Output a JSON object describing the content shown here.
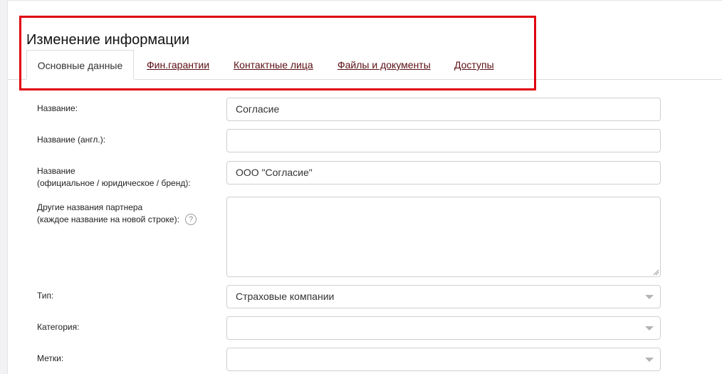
{
  "page": {
    "title": "Изменение информации"
  },
  "tabs": [
    {
      "label": "Основные данные",
      "active": true
    },
    {
      "label": "Фин.гарантии",
      "active": false
    },
    {
      "label": "Контактные лица",
      "active": false
    },
    {
      "label": "Файлы и документы",
      "active": false
    },
    {
      "label": "Доступы",
      "active": false
    }
  ],
  "form": {
    "name": {
      "label": "Название:",
      "value": "Согласие"
    },
    "name_en": {
      "label": "Название (англ.):",
      "value": ""
    },
    "official_name": {
      "label_line1": "Название",
      "label_line2": "(официальное / юридическое / бренд):",
      "value": "ООО \"Согласие\""
    },
    "other_names": {
      "label_line1": "Другие названия партнера",
      "label_line2": "(каждое название на новой строке):",
      "help_icon": "question-circle-icon",
      "help_glyph": "?",
      "value": ""
    },
    "type": {
      "label": "Тип:",
      "value": "Страховые компании"
    },
    "category": {
      "label": "Категория:",
      "value": ""
    },
    "tags": {
      "label": "Метки:",
      "value": ""
    }
  },
  "colors": {
    "highlight": "#e0000f",
    "link": "#5a0f14",
    "border": "#cfcfcf"
  }
}
